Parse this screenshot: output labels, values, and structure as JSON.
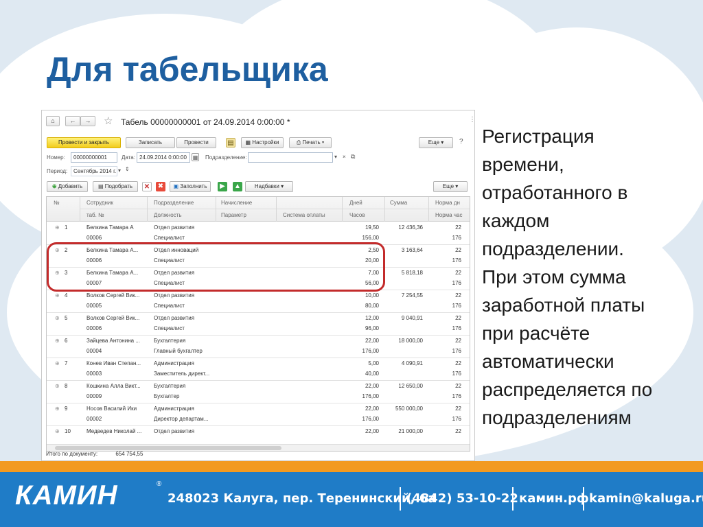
{
  "slide": {
    "title": "Для табельщика",
    "body_lines": [
      "Регистрация",
      "времени,",
      "отработанного в",
      "каждом",
      "подразделении.",
      "При этом сумма",
      "заработной платы",
      "при расчёте",
      "автоматически",
      "распределяется по",
      "подразделениям"
    ]
  },
  "window": {
    "doc_title": "Табель 00000000001 от 24.09.2014 0:00:00 *",
    "nav": {
      "home": "⌂",
      "back": "←",
      "forward": "→"
    },
    "toolbar": {
      "post_close": "Провести и закрыть",
      "save": "Записать",
      "post": "Провести",
      "settings": "Настройки",
      "print": "Печать",
      "more": "Еще"
    },
    "fields": {
      "number_label": "Номер:",
      "number_value": "00000000001",
      "date_label": "Дата:",
      "date_value": "24.09.2014 0:00:00",
      "division_label": "Подразделение:",
      "division_value": "",
      "period_label": "Период:",
      "period_value": "Сентябрь 2014 г."
    },
    "tab_toolbar": {
      "add": "Добавить",
      "pick": "Подобрать",
      "fill": "Заполнить",
      "bonuses": "Надбавки",
      "more": "Еще"
    },
    "table": {
      "headers_top": [
        "№",
        "Сотрудник",
        "Подразделение",
        "Начисление",
        "Дней",
        "Сумма",
        "Норма дн"
      ],
      "headers_bottom": [
        "таб. №",
        "Должность",
        "Параметр",
        "Система оплаты",
        "Часов",
        "Норма час"
      ],
      "rows": [
        {
          "n": "1",
          "emp": "Белкина Тамара А",
          "tab": "00006",
          "div": "Отдел развития",
          "pos": "Специалист",
          "days": "19,50",
          "hours": "156,00",
          "sum": "12 436,36",
          "nd": "22",
          "nh": "176"
        },
        {
          "n": "2",
          "emp": "Белкина Тамара А...",
          "tab": "00006",
          "div": "Отдел инноваций",
          "pos": "Специалист",
          "days": "2,50",
          "hours": "20,00",
          "sum": "3 163,64",
          "nd": "22",
          "nh": "176"
        },
        {
          "n": "3",
          "emp": "Белкина Тамара А...",
          "tab": "00007",
          "div": "Отдел развития",
          "pos": "Специалист",
          "days": "7,00",
          "hours": "56,00",
          "sum": "5 818,18",
          "nd": "22",
          "nh": "176"
        },
        {
          "n": "4",
          "emp": "Волков Сергей Вик...",
          "tab": "00005",
          "div": "Отдел развития",
          "pos": "Специалист",
          "days": "10,00",
          "hours": "80,00",
          "sum": "7 254,55",
          "nd": "22",
          "nh": "176"
        },
        {
          "n": "5",
          "emp": "Волков Сергей Вик...",
          "tab": "00006",
          "div": "Отдел развития",
          "pos": "Специалист",
          "days": "12,00",
          "hours": "96,00",
          "sum": "9 040,91",
          "nd": "22",
          "nh": "176"
        },
        {
          "n": "6",
          "emp": "Зайцева Антонина ...",
          "tab": "00004",
          "div": "Бухгалтерия",
          "pos": "Главный бухгалтер",
          "days": "22,00",
          "hours": "176,00",
          "sum": "18 000,00",
          "nd": "22",
          "nh": "176"
        },
        {
          "n": "7",
          "emp": "Конев Иван Степан...",
          "tab": "00003",
          "div": "Администрация",
          "pos": "Заместитель директ...",
          "days": "5,00",
          "hours": "40,00",
          "sum": "4 090,91",
          "nd": "22",
          "nh": "176"
        },
        {
          "n": "8",
          "emp": "Кошкина Алла Викт...",
          "tab": "00009",
          "div": "Бухгалтерия",
          "pos": "Бухгалтер",
          "days": "22,00",
          "hours": "176,00",
          "sum": "12 650,00",
          "nd": "22",
          "nh": "176"
        },
        {
          "n": "9",
          "emp": "Носов Василий Ики",
          "tab": "00002",
          "div": "Администрация",
          "pos": "Директор департам...",
          "days": "22,00",
          "hours": "176,00",
          "sum": "550 000,00",
          "nd": "22",
          "nh": "176"
        },
        {
          "n": "10",
          "emp": "Медведев Николай ...",
          "tab": "",
          "div": "Отдел развития",
          "pos": "",
          "days": "22,00",
          "hours": "",
          "sum": "21 000,00",
          "nd": "22",
          "nh": ""
        }
      ]
    },
    "total_label": "Итого по документу:",
    "total_value": "654 754,55"
  },
  "footer": {
    "logo": "КАМИН",
    "logo_reg": "®",
    "address": "248023 Калуга, пер. Теренинский, 6а",
    "phone": "(4842) 53-10-22",
    "site": "камин.рф",
    "email": "kamin@kaluga.ru"
  },
  "colors": {
    "title": "#1e5fa0",
    "footer_blue": "#1f7cc7",
    "footer_orange": "#f29a21",
    "highlight_red": "#c32b2b",
    "primary_button": "#f2cc1c"
  }
}
